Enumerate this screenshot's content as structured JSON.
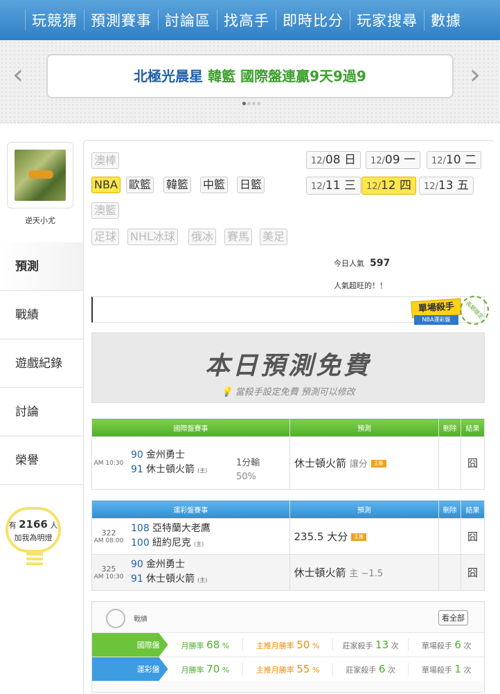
{
  "nav": [
    "玩競猜",
    "預測賽事",
    "討論區",
    "找高手",
    "即時比分",
    "玩家搜尋",
    "數據"
  ],
  "banner": {
    "part1": "北極光晨星",
    "part2": "韓籃 國際盤連贏9天9過9",
    "prev": "‹",
    "next": "›"
  },
  "user": {
    "name": "逆天小尤"
  },
  "side_tabs": [
    "預測",
    "戰績",
    "遊戲紀錄",
    "討論",
    "榮譽"
  ],
  "bulb": {
    "prefix": "有",
    "count": "2166",
    "suffix": "人",
    "line2": "加我為明燈"
  },
  "sports": [
    {
      "label": "澳棒",
      "state": "dis"
    },
    {
      "label": "NBA",
      "state": "sel"
    },
    {
      "label": "歐籃",
      "state": "on"
    },
    {
      "label": "韓籃",
      "state": "on"
    },
    {
      "label": "中籃",
      "state": "on"
    },
    {
      "label": "日籃",
      "state": "on"
    },
    {
      "label": "澳籃",
      "state": "dis"
    },
    {
      "label": "足球",
      "state": "dis"
    },
    {
      "label": "NHL冰球",
      "state": "dis"
    },
    {
      "label": "俄冰",
      "state": "dis"
    },
    {
      "label": "賽馬",
      "state": "dis"
    },
    {
      "label": "美足",
      "state": "dis"
    }
  ],
  "dates": [
    {
      "d": "12/",
      "n": "08 日"
    },
    {
      "d": "12/",
      "n": "09 一"
    },
    {
      "d": "12/",
      "n": "10 二"
    },
    {
      "d": "12/",
      "n": "11 三"
    },
    {
      "d": "12/",
      "n": "12 四"
    },
    {
      "d": "12/",
      "n": "13 五"
    }
  ],
  "popularity": {
    "label": "今日人氣",
    "value": "597",
    "note": "人氣超旺的！！"
  },
  "badge": {
    "title": "單場殺手",
    "sub": "NBA運彩盤",
    "ring": "長期穩定"
  },
  "free": {
    "title": "本日預測免費",
    "sub": "當殺手設定免費 預測可以修改"
  },
  "intl": {
    "headers": [
      "國際盤賽事",
      "預測",
      "刪除",
      "結果"
    ],
    "time": "AM 10:30",
    "away": {
      "num": "90",
      "team": "金州勇士"
    },
    "home": {
      "num": "91",
      "team": "休士頓火箭",
      "mark": "(主)"
    },
    "line": "1分輸",
    "pct": "50%",
    "pick": "休士頓火箭",
    "pick_note": "讓分",
    "tag": "主推",
    "result": "囧"
  },
  "sport": {
    "headers": [
      "運彩盤賽事",
      "預測",
      "刪除",
      "結果"
    ],
    "games": [
      {
        "id": "322",
        "time": "AM 08:00",
        "away_num": "108",
        "away": "亞特蘭大老鷹",
        "home_num": "100",
        "home": "紐約尼克",
        "mark": "(主)",
        "pick": "235.5 大分",
        "note": "",
        "tag": "主推",
        "result": "囧"
      },
      {
        "id": "325",
        "time": "AM 10:30",
        "away_num": "90",
        "away": "金州勇士",
        "home_num": "91",
        "home": "休士頓火箭",
        "mark": "(主)",
        "pick": "休士頓火箭",
        "note": "主 −1.5",
        "tag": "",
        "result": "囧"
      }
    ]
  },
  "record": {
    "label": "戰績",
    "all": "看全部",
    "rows": [
      {
        "name": "國際盤",
        "color": "#6cc43c",
        "m_label": "月勝率",
        "m": "68",
        "p": "%",
        "h_label": "主推月勝率",
        "h": "50",
        "k_label": "莊家殺手",
        "k": "13",
        "k_unit": "次",
        "s_label": "單場殺手",
        "s": "6",
        "s_unit": "次"
      },
      {
        "name": "運彩盤",
        "color": "#3d9be0",
        "m_label": "月勝率",
        "m": "70",
        "p": "%",
        "h_label": "主推月勝率",
        "h": "55",
        "k_label": "莊家殺手",
        "k": "6",
        "k_unit": "次",
        "s_label": "單場殺手",
        "s": "1",
        "s_unit": "次"
      }
    ]
  }
}
